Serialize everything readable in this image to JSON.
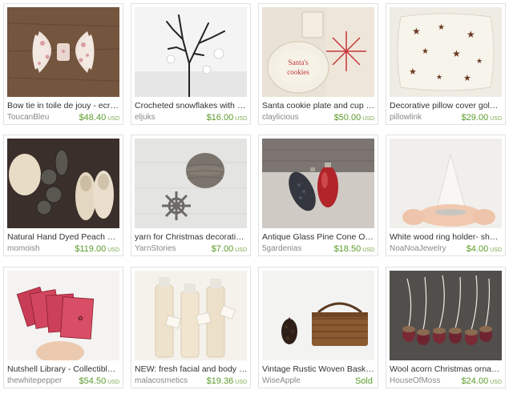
{
  "listings": [
    {
      "title": "Bow tie in toile de jouy - ecru and red",
      "shop": "ToucanBleu",
      "price": "$48.40",
      "currency": "USD",
      "image": "bow-tie-photo"
    },
    {
      "title": "Crocheted snowflakes with hanging branch",
      "shop": "eljuks",
      "price": "$16.00",
      "currency": "USD",
      "image": "snowflake-branch-photo"
    },
    {
      "title": "Santa cookie plate and cup set",
      "shop": "claylicious",
      "price": "$50.00",
      "currency": "USD",
      "image": "cookie-plate-photo"
    },
    {
      "title": "Decorative pillow cover gold stars",
      "shop": "pillowlink",
      "price": "$29.00",
      "currency": "USD",
      "image": "star-pillow-photo"
    },
    {
      "title": "Natural Hand Dyed Peach Wool Slippers",
      "shop": "momoish",
      "price": "$119.00",
      "currency": "USD",
      "image": "wool-slippers-photo"
    },
    {
      "title": "yarn for Christmas decorations linen",
      "shop": "YarnStories",
      "price": "$7.00",
      "currency": "USD",
      "image": "yarn-ball-photo"
    },
    {
      "title": "Antique Glass Pine Cone Ornaments",
      "shop": "5gardenias",
      "price": "$18.50",
      "currency": "USD",
      "image": "glass-ornaments-photo"
    },
    {
      "title": "White wood ring holder- shabby chic",
      "shop": "NoaNoaJewelry",
      "price": "$4.00",
      "currency": "USD",
      "image": "ring-holder-photo"
    },
    {
      "title": "Nutshell Library - Collectible red books",
      "shop": "thewhitepepper",
      "price": "$54.50",
      "currency": "USD",
      "image": "red-books-photo"
    },
    {
      "title": "NEW: fresh facial and body lotion set",
      "shop": "malacosmetics",
      "price": "$19.36",
      "currency": "USD",
      "image": "lotion-bottles-photo"
    },
    {
      "title": "Vintage Rustic Woven Basket with handle",
      "shop": "WiseApple",
      "price": "Sold",
      "currency": "",
      "image": "woven-basket-photo"
    },
    {
      "title": "Wool acorn Christmas ornaments set",
      "shop": "HouseOfMoss",
      "price": "$24.00",
      "currency": "USD",
      "image": "acorn-ornaments-photo"
    }
  ]
}
